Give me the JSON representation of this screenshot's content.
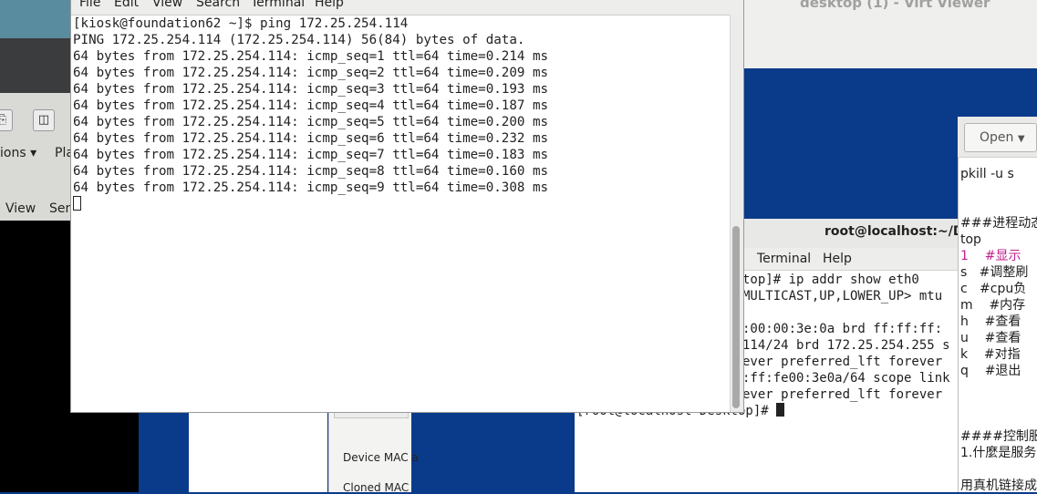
{
  "background_left": {
    "menu_items": [
      "ions ▾",
      "Pla"
    ],
    "menu2_items": [
      "View",
      "Sen"
    ]
  },
  "device_panel": {
    "labels": [
      "Device MAC a",
      "Cloned MAC"
    ]
  },
  "viewer": {
    "title": "desktop (1) - Virt Viewer"
  },
  "root_terminal": {
    "title": "root@localhost:~/De",
    "menu": [
      "Terminal",
      "Help"
    ],
    "lines": [
      "top]# ip addr show eth0",
      "MULTICAST,UP,LOWER_UP> mtu",
      "",
      ":00:00:3e:0a brd ff:ff:ff:",
      "114/24 brd 172.25.254.255 s",
      "ever preferred_lft forever",
      ":ff:fe00:3e0a/64 scope link",
      "ever preferred_lft forever",
      "[root@localhost Desktop]# "
    ]
  },
  "editor": {
    "open_label": "Open",
    "lines": [
      "",
      "pkill -u s",
      "",
      "",
      "###进程动态",
      "top",
      "1    #显示",
      "s   #调整刷",
      "c   #cpu负",
      "m    #内存",
      "h    #查看",
      "u    #查看",
      "k    #对指",
      "q    #退出",
      "",
      "",
      "",
      "####控制服务",
      "1.什麼是服务",
      "",
      "用真机链接成"
    ]
  },
  "main_terminal": {
    "menu": [
      "File",
      "Edit",
      "View",
      "Search",
      "Terminal",
      "Help"
    ],
    "lines": [
      "[kiosk@foundation62 ~]$ ping 172.25.254.114",
      "PING 172.25.254.114 (172.25.254.114) 56(84) bytes of data.",
      "64 bytes from 172.25.254.114: icmp_seq=1 ttl=64 time=0.214 ms",
      "64 bytes from 172.25.254.114: icmp_seq=2 ttl=64 time=0.209 ms",
      "64 bytes from 172.25.254.114: icmp_seq=3 ttl=64 time=0.193 ms",
      "64 bytes from 172.25.254.114: icmp_seq=4 ttl=64 time=0.187 ms",
      "64 bytes from 172.25.254.114: icmp_seq=5 ttl=64 time=0.200 ms",
      "64 bytes from 172.25.254.114: icmp_seq=6 ttl=64 time=0.232 ms",
      "64 bytes from 172.25.254.114: icmp_seq=7 ttl=64 time=0.183 ms",
      "64 bytes from 172.25.254.114: icmp_seq=8 ttl=64 time=0.160 ms",
      "64 bytes from 172.25.254.114: icmp_seq=9 ttl=64 time=0.308 ms"
    ]
  }
}
